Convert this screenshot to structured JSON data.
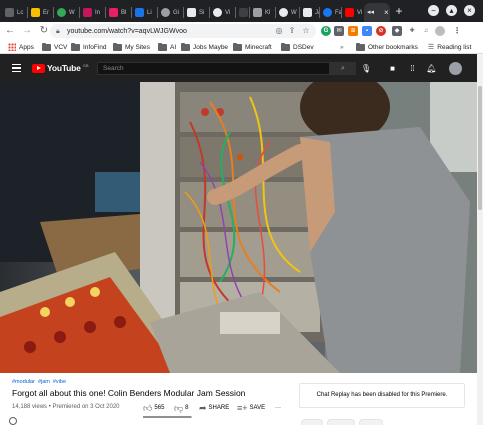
{
  "browser": {
    "tabs": [
      {
        "label": "Lc",
        "color": "#5f6368"
      },
      {
        "label": "Er",
        "color": "#fbbc04"
      },
      {
        "label": "W",
        "color": "#34a853"
      },
      {
        "label": "In",
        "color": "#c2185b"
      },
      {
        "label": "Bl",
        "color": "#e91e63"
      },
      {
        "label": "Li",
        "color": "#1a73e8"
      },
      {
        "label": "Gi",
        "color": "#9aa0a6"
      },
      {
        "label": "Si",
        "color": "#e8eaed"
      },
      {
        "label": "Vi",
        "color": "#e8eaed"
      },
      {
        "label": "",
        "color": "#3c4043"
      },
      {
        "label": "Kl",
        "color": "#9aa0a6"
      },
      {
        "label": "W",
        "color": "#e8eaed"
      },
      {
        "label": "Ja",
        "color": "#e8eaed"
      },
      {
        "label": "Fa",
        "color": "#1877f2"
      },
      {
        "label": "Vi",
        "color": "#ff0000"
      }
    ],
    "active_tab_label": "",
    "active_tab_close": "×",
    "new_tab": "+",
    "url": "youtube.com/watch?v=aqvLWJGWvoo",
    "bookmarks": {
      "apps": "Apps",
      "items": [
        "VCV",
        "InfoFind",
        "My Sites",
        "AI",
        "Jobs Maybe",
        "Minecraft",
        "DSDev"
      ],
      "more": "»",
      "other": "Other bookmarks",
      "reading": "Reading list"
    }
  },
  "youtube": {
    "logo": "YouTube",
    "logo_country": "GB",
    "search_placeholder": "Search",
    "hashtags": [
      "#modular",
      "#jam",
      "#vibe"
    ],
    "title": "Forgot all about this one! Colin Benders Modular Jam Session",
    "views": "14,188 views",
    "premiered": "Premiered on 3 Oct 2020",
    "likes": "565",
    "dislikes": "8",
    "like_ratio": 0.986,
    "share": "SHARE",
    "save": "SAVE",
    "more": "···",
    "chat_replay": "Chat Replay has been disabled for this Premiere."
  }
}
